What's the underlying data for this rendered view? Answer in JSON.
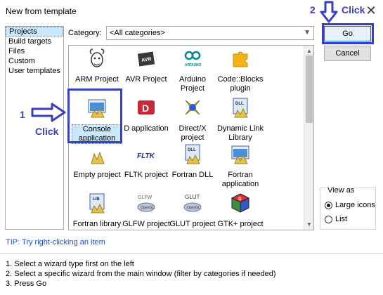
{
  "window": {
    "title": "New from template",
    "close_glyph": "✕"
  },
  "left_panel": {
    "items": [
      {
        "label": "Projects",
        "selected": true
      },
      {
        "label": "Build targets",
        "selected": false
      },
      {
        "label": "Files",
        "selected": false
      },
      {
        "label": "Custom",
        "selected": false
      },
      {
        "label": "User templates",
        "selected": false
      }
    ]
  },
  "category": {
    "label": "Category:",
    "value": "<All categories>"
  },
  "templates": [
    {
      "label": "ARM Project",
      "icon": "gnu-icon"
    },
    {
      "label": "AVR Project",
      "icon": "avr-chip-icon"
    },
    {
      "label": "Arduino Project",
      "icon": "arduino-icon"
    },
    {
      "label": "Code::Blocks plugin",
      "icon": "puzzle-plugin-icon"
    },
    {
      "label": "Console application",
      "icon": "console-app-icon",
      "selected": true
    },
    {
      "label": "D application",
      "icon": "d-lang-icon"
    },
    {
      "label": "Direct/X project",
      "icon": "directx-icon"
    },
    {
      "label": "Dynamic Link Library",
      "icon": "dll-icon"
    },
    {
      "label": "Empty project",
      "icon": "empty-project-icon"
    },
    {
      "label": "FLTK project",
      "icon": "fltk-icon"
    },
    {
      "label": "Fortran DLL",
      "icon": "fortran-dll-icon"
    },
    {
      "label": "Fortran application",
      "icon": "fortran-app-icon"
    },
    {
      "label": "Fortran library",
      "icon": "fortran-lib-icon"
    },
    {
      "label": "GLFW project",
      "icon": "glfw-icon"
    },
    {
      "label": "GLUT project",
      "icon": "glut-icon"
    },
    {
      "label": "GTK+ project",
      "icon": "gtk-icon"
    }
  ],
  "buttons": {
    "go": "Go",
    "cancel": "Cancel"
  },
  "view_as": {
    "title": "View as",
    "options": [
      {
        "label": "Large icons",
        "selected": true
      },
      {
        "label": "List",
        "selected": false
      }
    ]
  },
  "tip": "TIP: Try right-clicking an item",
  "steps": [
    "1. Select a wizard type first on the left",
    "2. Select a specific wizard from the main window (filter by categories if needed)",
    "3. Press Go"
  ],
  "annotations": {
    "step1_number": "1",
    "step1_text": "Click",
    "step2_number": "2",
    "step2_text": "Click"
  },
  "colors": {
    "annotation": "#3a3fbf",
    "selection": "#cce8ff",
    "tip": "#1a50c8"
  }
}
